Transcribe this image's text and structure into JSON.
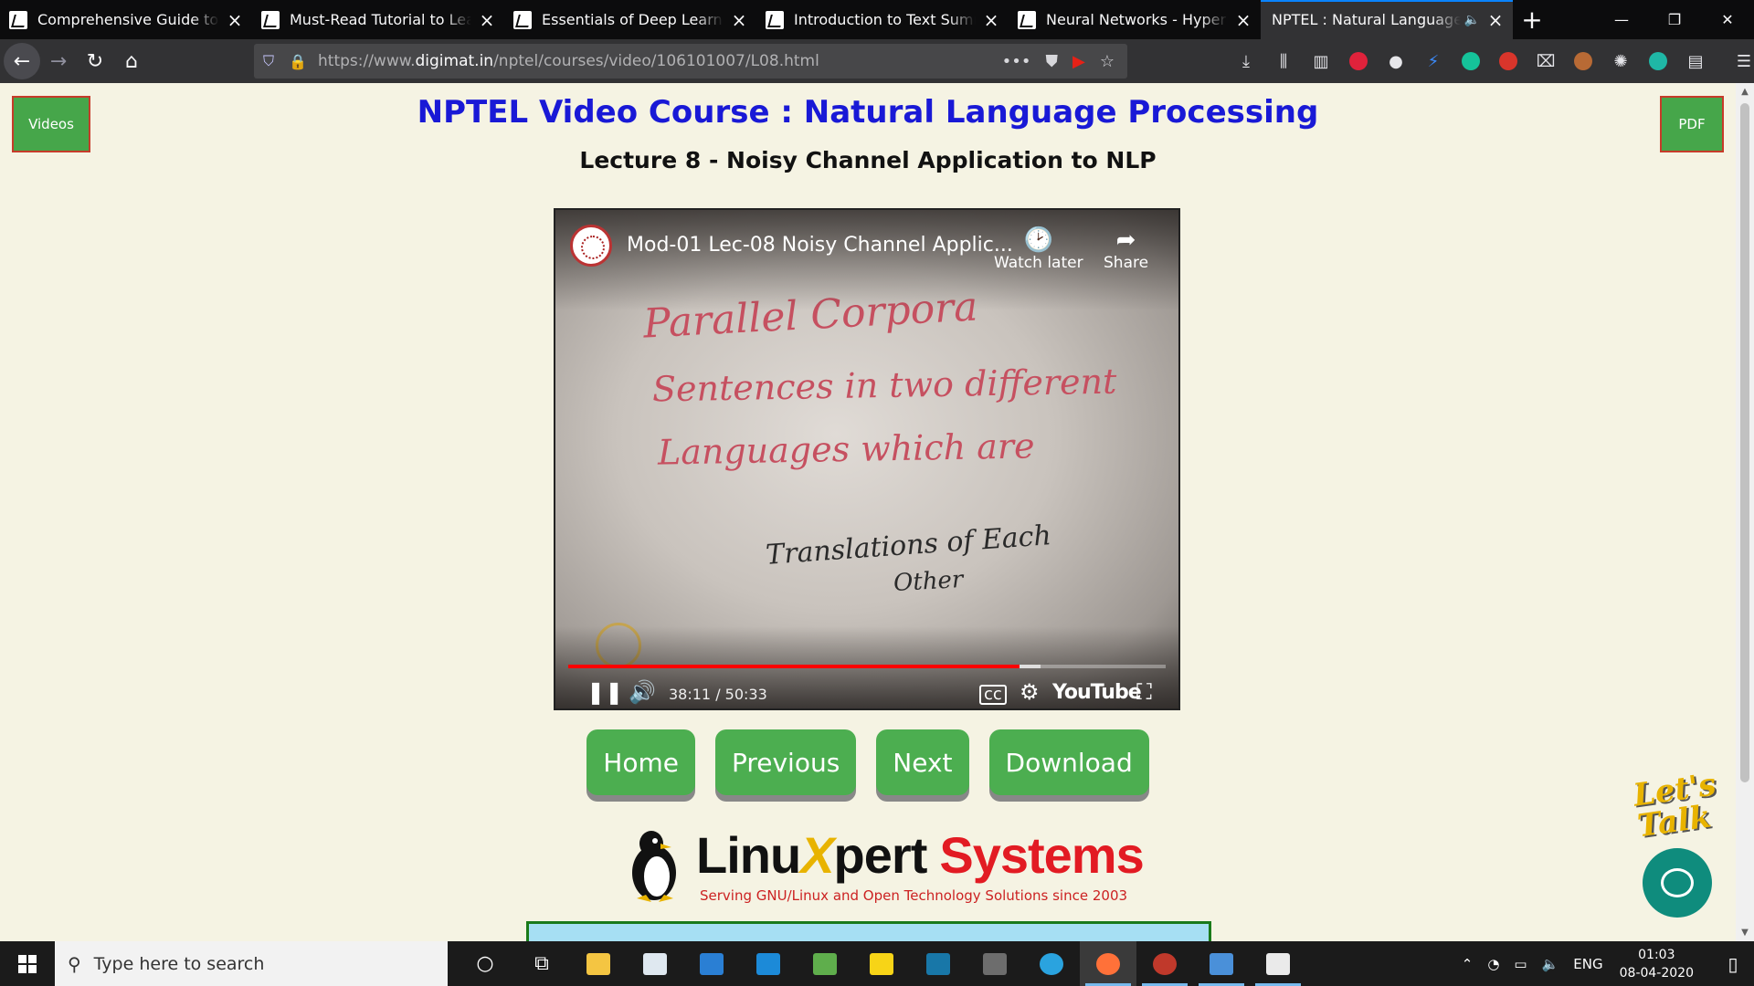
{
  "browser": {
    "tabs": [
      {
        "title": "Comprehensive Guide to Text Summarization",
        "active": false
      },
      {
        "title": "Must-Read Tutorial to Learn Sequence Modeling",
        "active": false
      },
      {
        "title": "Essentials of Deep Learning : Introduction",
        "active": false
      },
      {
        "title": "Introduction to Text Summarization",
        "active": false
      },
      {
        "title": "Neural Networks - Hyperparameter Tuning",
        "active": false
      },
      {
        "title": "NPTEL : Natural Language Processing",
        "active": true
      }
    ],
    "new_tab": "+",
    "url_prefix": "https://www.",
    "url_domain": "digimat.in",
    "url_path": "/nptel/courses/video/106101007/L08.html",
    "win_minimize": "—",
    "win_restore": "❐",
    "win_close": "✕"
  },
  "page": {
    "videos_button": "Videos",
    "pdf_button": "PDF",
    "course_title": "NPTEL Video Course : Natural Language Processing",
    "lecture_title": "Lecture 8 - Noisy Channel Application to NLP"
  },
  "video": {
    "title": "Mod-01 Lec-08 Noisy Channel Applic...",
    "watch_later": "Watch later",
    "share": "Share",
    "current_time": "38:11",
    "duration": "50:33",
    "time_display": "38:11 / 50:33",
    "progress_fraction": 0.7547,
    "buffered_fraction": 0.79,
    "player_brand": "YouTube",
    "board_text": {
      "line1": "Parallel Corpora",
      "line2": "Sentences in two different",
      "line3": "Languages which are",
      "line4": "Translations of Each",
      "line5": "Other"
    }
  },
  "nav_buttons": {
    "home": "Home",
    "previous": "Previous",
    "next": "Next",
    "download": "Download"
  },
  "sponsor": {
    "word_linu": "Linu",
    "word_x": "X",
    "word_pert": "pert",
    "word_systems": "Systems",
    "tagline": "Serving GNU/Linux and Open Technology Solutions since 2003"
  },
  "chat": {
    "teaser": "Let's Talk"
  },
  "taskbar": {
    "search_placeholder": "Type here to search",
    "language": "ENG",
    "time": "01:03",
    "date": "08-04-2020"
  }
}
